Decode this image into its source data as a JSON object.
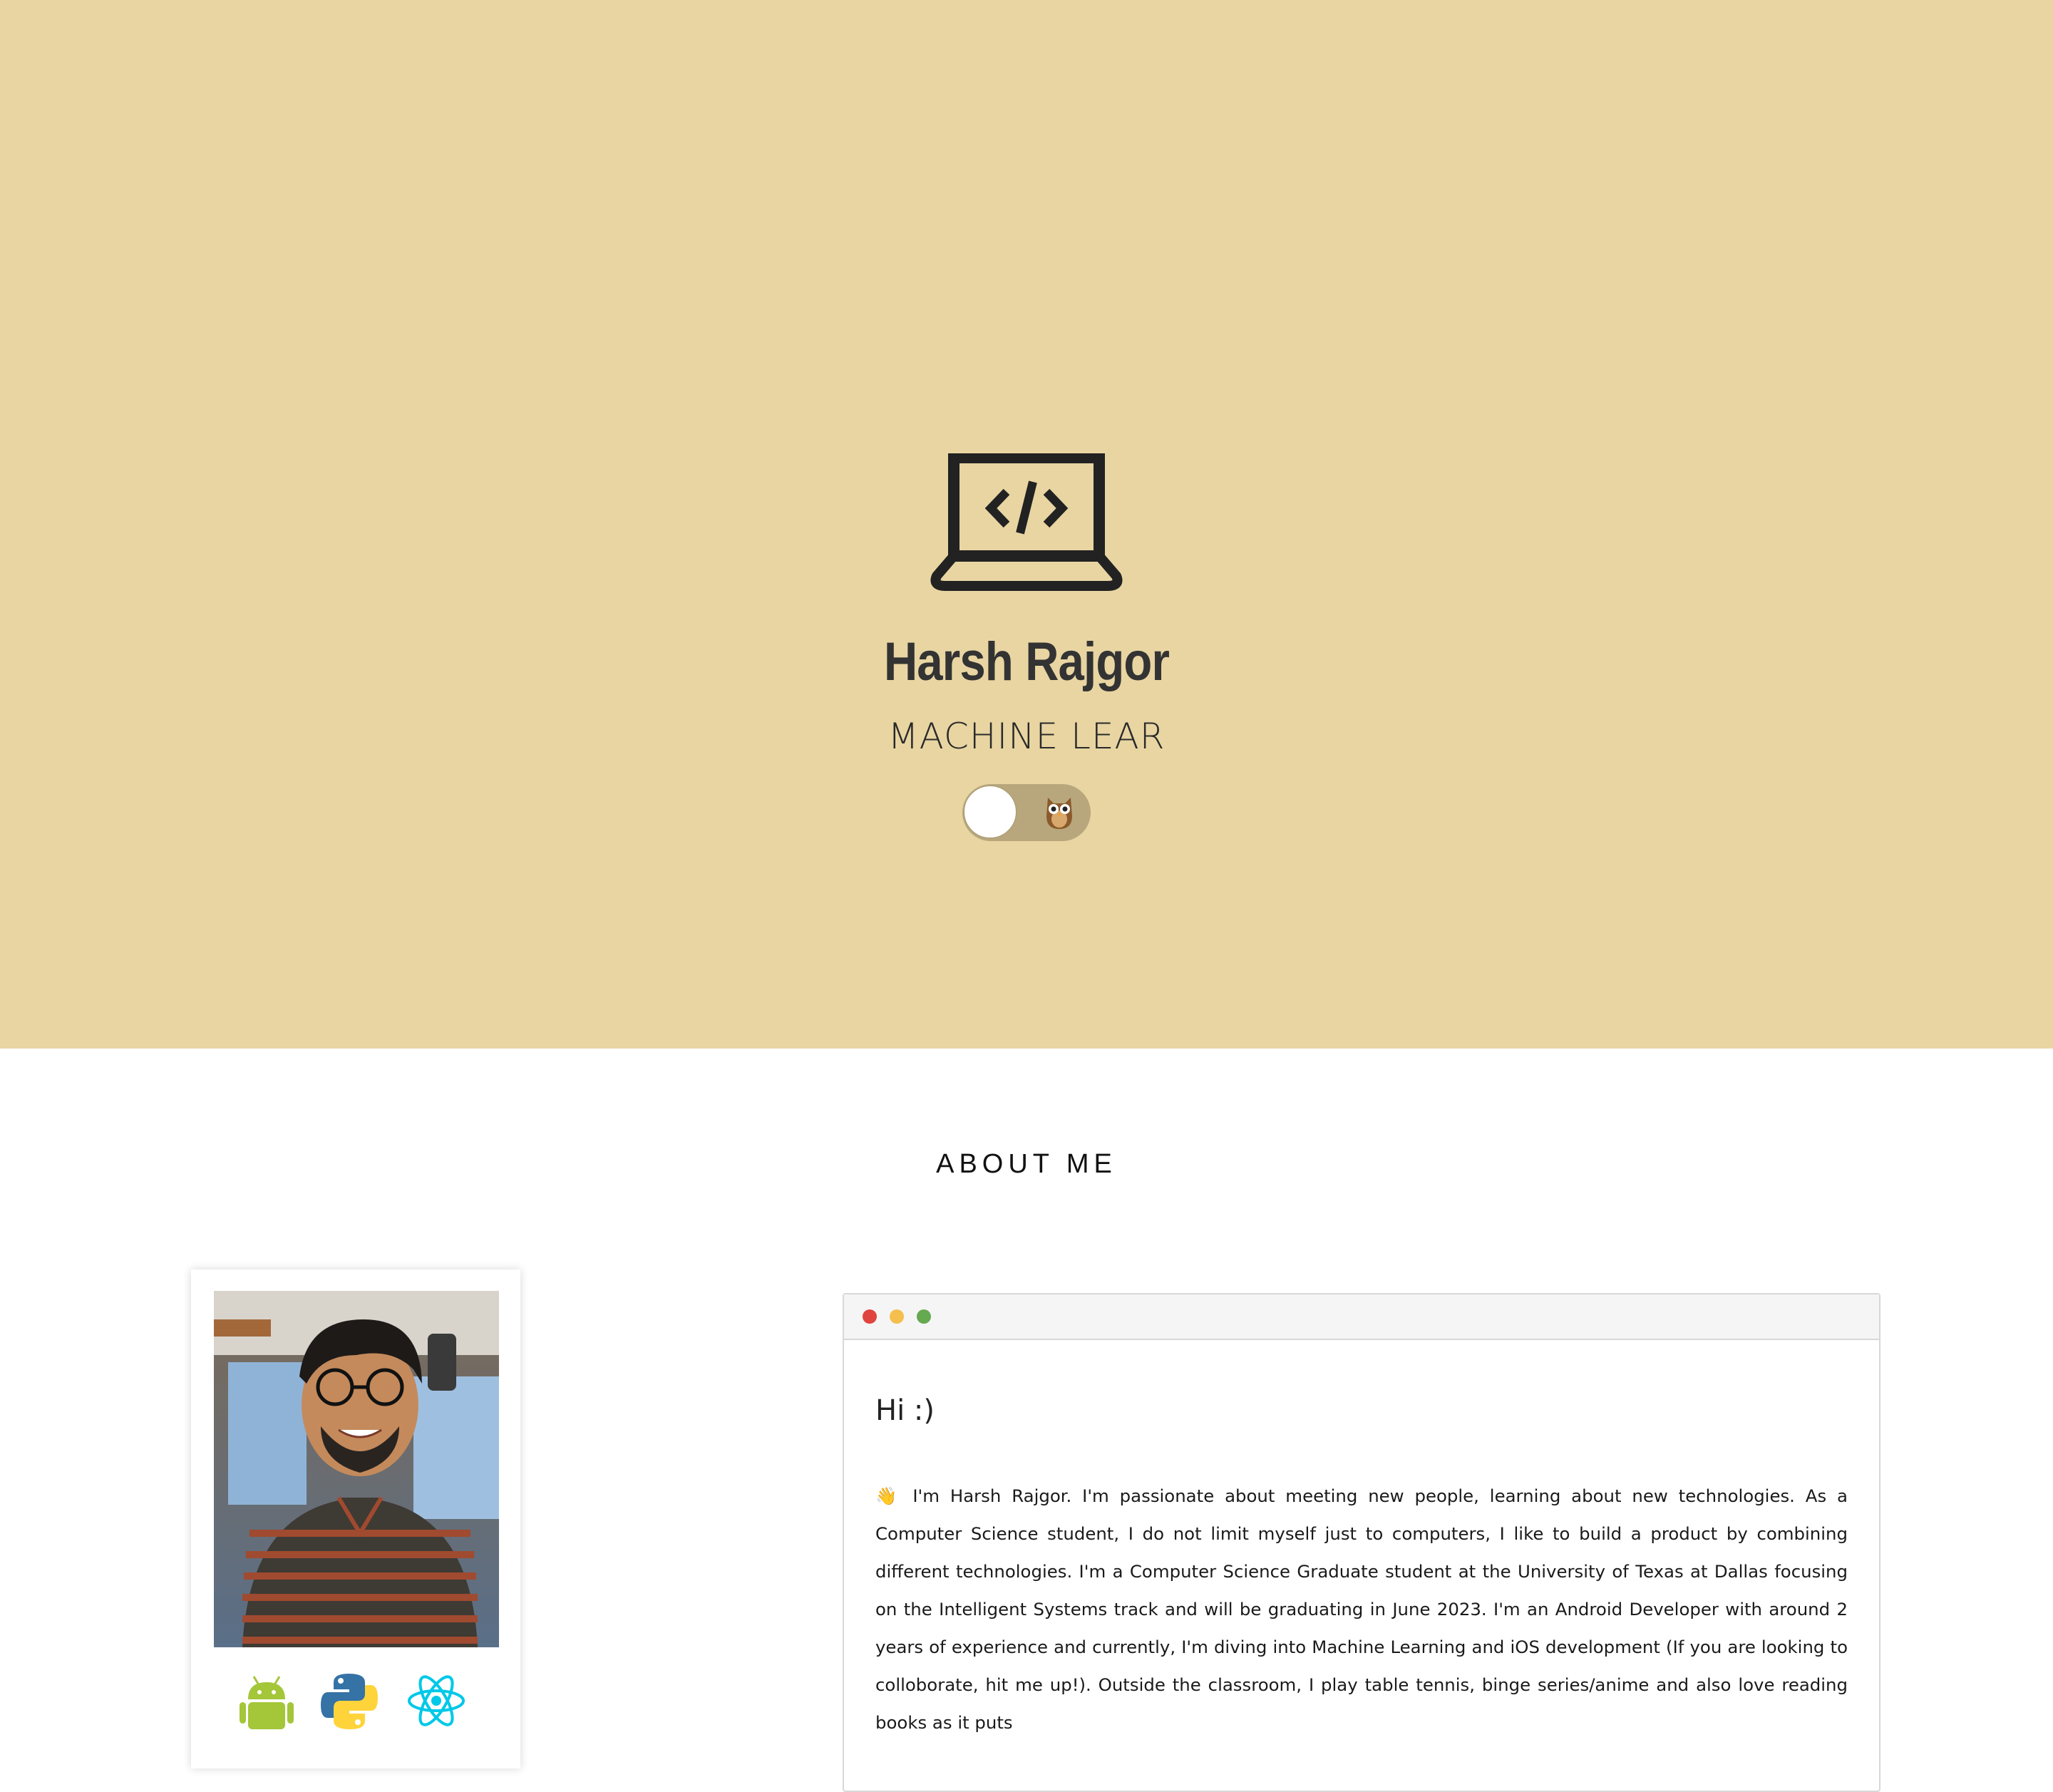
{
  "hero": {
    "name": "Harsh Rajgor",
    "subtitle": "MACHINE LEAR",
    "background_color": "#e8d5a2",
    "logo_icon": "laptop-code-icon",
    "theme_toggle": {
      "state": "off",
      "icon": "owl-icon"
    }
  },
  "about": {
    "section_title": "ABOUT ME",
    "photo_card": {
      "photo_alt": "profile-photo",
      "skill_icons": [
        "android-icon",
        "python-icon",
        "react-icon"
      ]
    },
    "terminal": {
      "window_dots": [
        "#e0443e",
        "#f4bf4f",
        "#65a950"
      ],
      "heading": "Hi :)",
      "body": "👋 I'm Harsh Rajgor. I'm passionate about meeting new people, learning about new technologies. As a Computer Science student, I do not limit myself just to computers, I like to build a product by combining different technologies. I'm a Computer Science Graduate student at the University of Texas at Dallas focusing on the Intelligent Systems track and will be graduating in June 2023. I'm an Android Developer with around 2 years of experience and currently, I'm diving into Machine Learning and iOS development (If you are looking to colloborate, hit me up!). Outside the classroom, I play table tennis, binge series/anime and also love reading books as it puts"
    }
  }
}
